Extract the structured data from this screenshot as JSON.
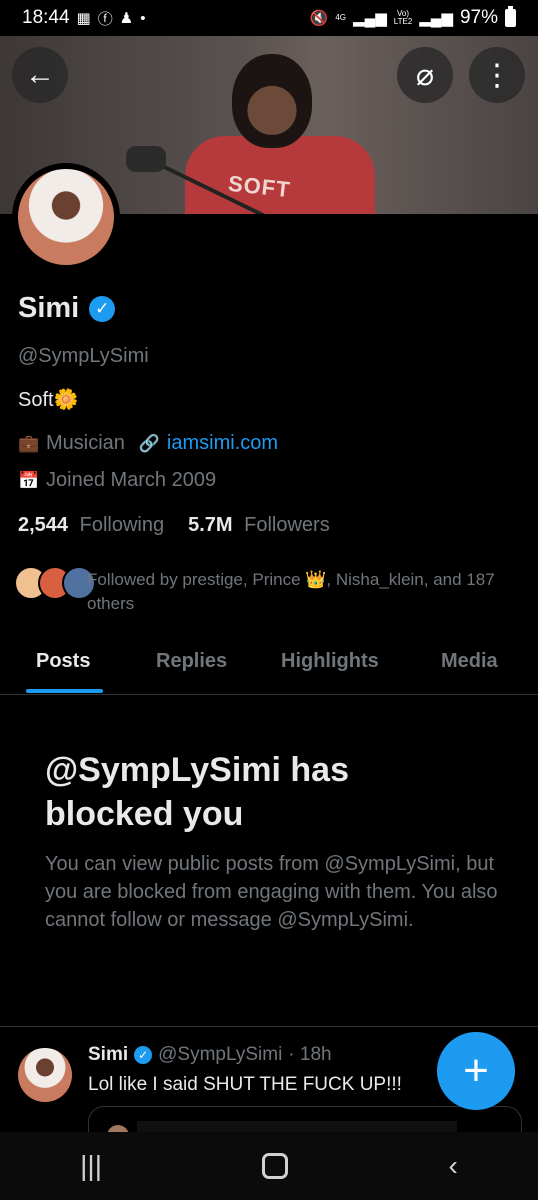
{
  "status_bar": {
    "time": "18:44",
    "left_icons": [
      "qr-icon",
      "facebook-icon",
      "snapchat-icon",
      "dot-icon"
    ],
    "net_4g": "4G",
    "volte": "Vo)",
    "lte2": "LTE2",
    "battery": "97%"
  },
  "header": {
    "back_icon": "←",
    "grok_icon": "⌀",
    "more_icon": "⋮",
    "banner_text": "SOFT"
  },
  "profile": {
    "name": "Simi",
    "verified_icon": "✓",
    "handle": "@SympLySimi",
    "bio_text": "Soft",
    "bio_emoji": "🌼",
    "category": "Musician",
    "website": "iamsimi.com",
    "joined": "Joined March 2009",
    "following_count": "2,544",
    "following_label": "Following",
    "followers_count": "5.7M",
    "followers_label": "Followers",
    "followed_by": "Followed by prestige, Prince 👑, Nisha_klein, and 187 others"
  },
  "tabs": {
    "posts": "Posts",
    "replies": "Replies",
    "highlights": "Highlights",
    "media": "Media"
  },
  "blocked": {
    "title": "@SympLySimi has blocked you",
    "body": "You can view public posts from @SympLySimi, but you are blocked from engaging with them. You also cannot follow or message @SympLySimi."
  },
  "post": {
    "name": "Simi",
    "handle": "@SympLySimi",
    "time": "· 18h",
    "text": "Lol like I said SHUT THE FUCK UP!!!"
  },
  "fab_icon": "+",
  "nav": {
    "recents": "|||",
    "back": "‹"
  },
  "colors": {
    "accent": "#1d9bf0",
    "background": "#000000",
    "muted_text": "#71767b"
  }
}
